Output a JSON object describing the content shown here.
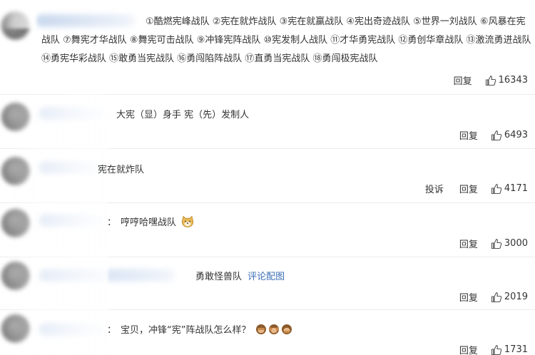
{
  "comments": [
    {
      "text": "①酷燃宪峰战队 ②宪在就炸战队 ③宪在就赢战队 ④宪出奇迹战队 ⑤世界一刘战队 ⑥风暴在宪战队 ⑦舞宪才华战队 ⑧舞宪可击战队 ⑨冲锋宪阵战队 ⑩宪发制人战队 ⑪才华勇宪战队 ⑫勇创华章战队 ⑬激流勇进战队 ⑭勇宪华彩战队 ⑮敢勇当宪战队 ⑯勇闯陷阵战队 ⑰直勇当宪战队 ⑱勇闯极宪战队",
      "reply": "回复",
      "likes": "16343"
    },
    {
      "text": "大宪（显）身手 宪（先）发制人",
      "reply": "回复",
      "likes": "6493"
    },
    {
      "text": "宪在就炸队",
      "report": "投诉",
      "reply": "回复",
      "likes": "4171"
    },
    {
      "prefix": "：",
      "text": "哼哼哈嘿战队",
      "reply": "回复",
      "likes": "3000"
    },
    {
      "text": "勇敢怪兽队",
      "link": "评论配图",
      "reply": "回复",
      "likes": "2019"
    },
    {
      "prefix": "：",
      "text": "宝贝，冲锋“宪”阵战队怎么样？",
      "reply": "回复",
      "likes": "1731"
    }
  ],
  "icons": {
    "like": "thumbs-up-icon",
    "dog_emoji": "doge-emoji-icon",
    "monkey_emoji": "monkey-emoji-icon"
  },
  "colors": {
    "link": "#3d6fb5",
    "divider": "#ececec"
  }
}
